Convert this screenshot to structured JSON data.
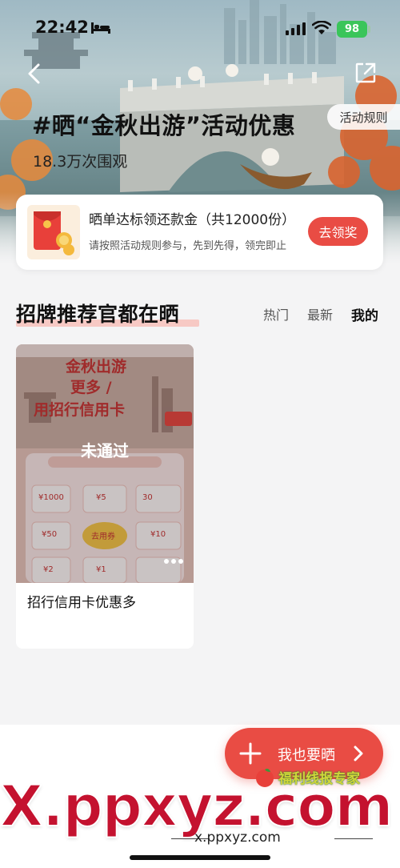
{
  "status_bar": {
    "time": "22:42",
    "battery": "98"
  },
  "hero": {
    "title": "#晒“金秋出游”活动优惠",
    "views": "18.3万次围观",
    "rules_label": "活动规则"
  },
  "promo": {
    "title": "晒单达标领还款金（共12000份）",
    "subtitle": "请按照活动规则参与，先到先得，领完即止",
    "button_label": "去领奖"
  },
  "section": {
    "title": "招牌推荐官都在晒",
    "tabs": [
      "热门",
      "最新",
      "我的"
    ],
    "active_tab": "我的"
  },
  "post": {
    "status": "未通过",
    "title": "招行信用卡优惠多",
    "image_texts": {
      "line1": "金秋出游",
      "line2": "更多 /",
      "line3": "用招行信用卡",
      "coupons": [
        "¥1000",
        "¥5",
        "30",
        "¥50",
        "去用券",
        "¥10",
        "¥2",
        "¥1"
      ]
    }
  },
  "fab": {
    "label": "我也要晒"
  },
  "watermark": {
    "badge": "福利线报专家",
    "logo": "X.ppxyz.com",
    "url": "x.ppxyz.com"
  },
  "colors": {
    "accent": "#e94c44",
    "section_underline": "#f7c9c4",
    "battery": "#3ac55a"
  }
}
